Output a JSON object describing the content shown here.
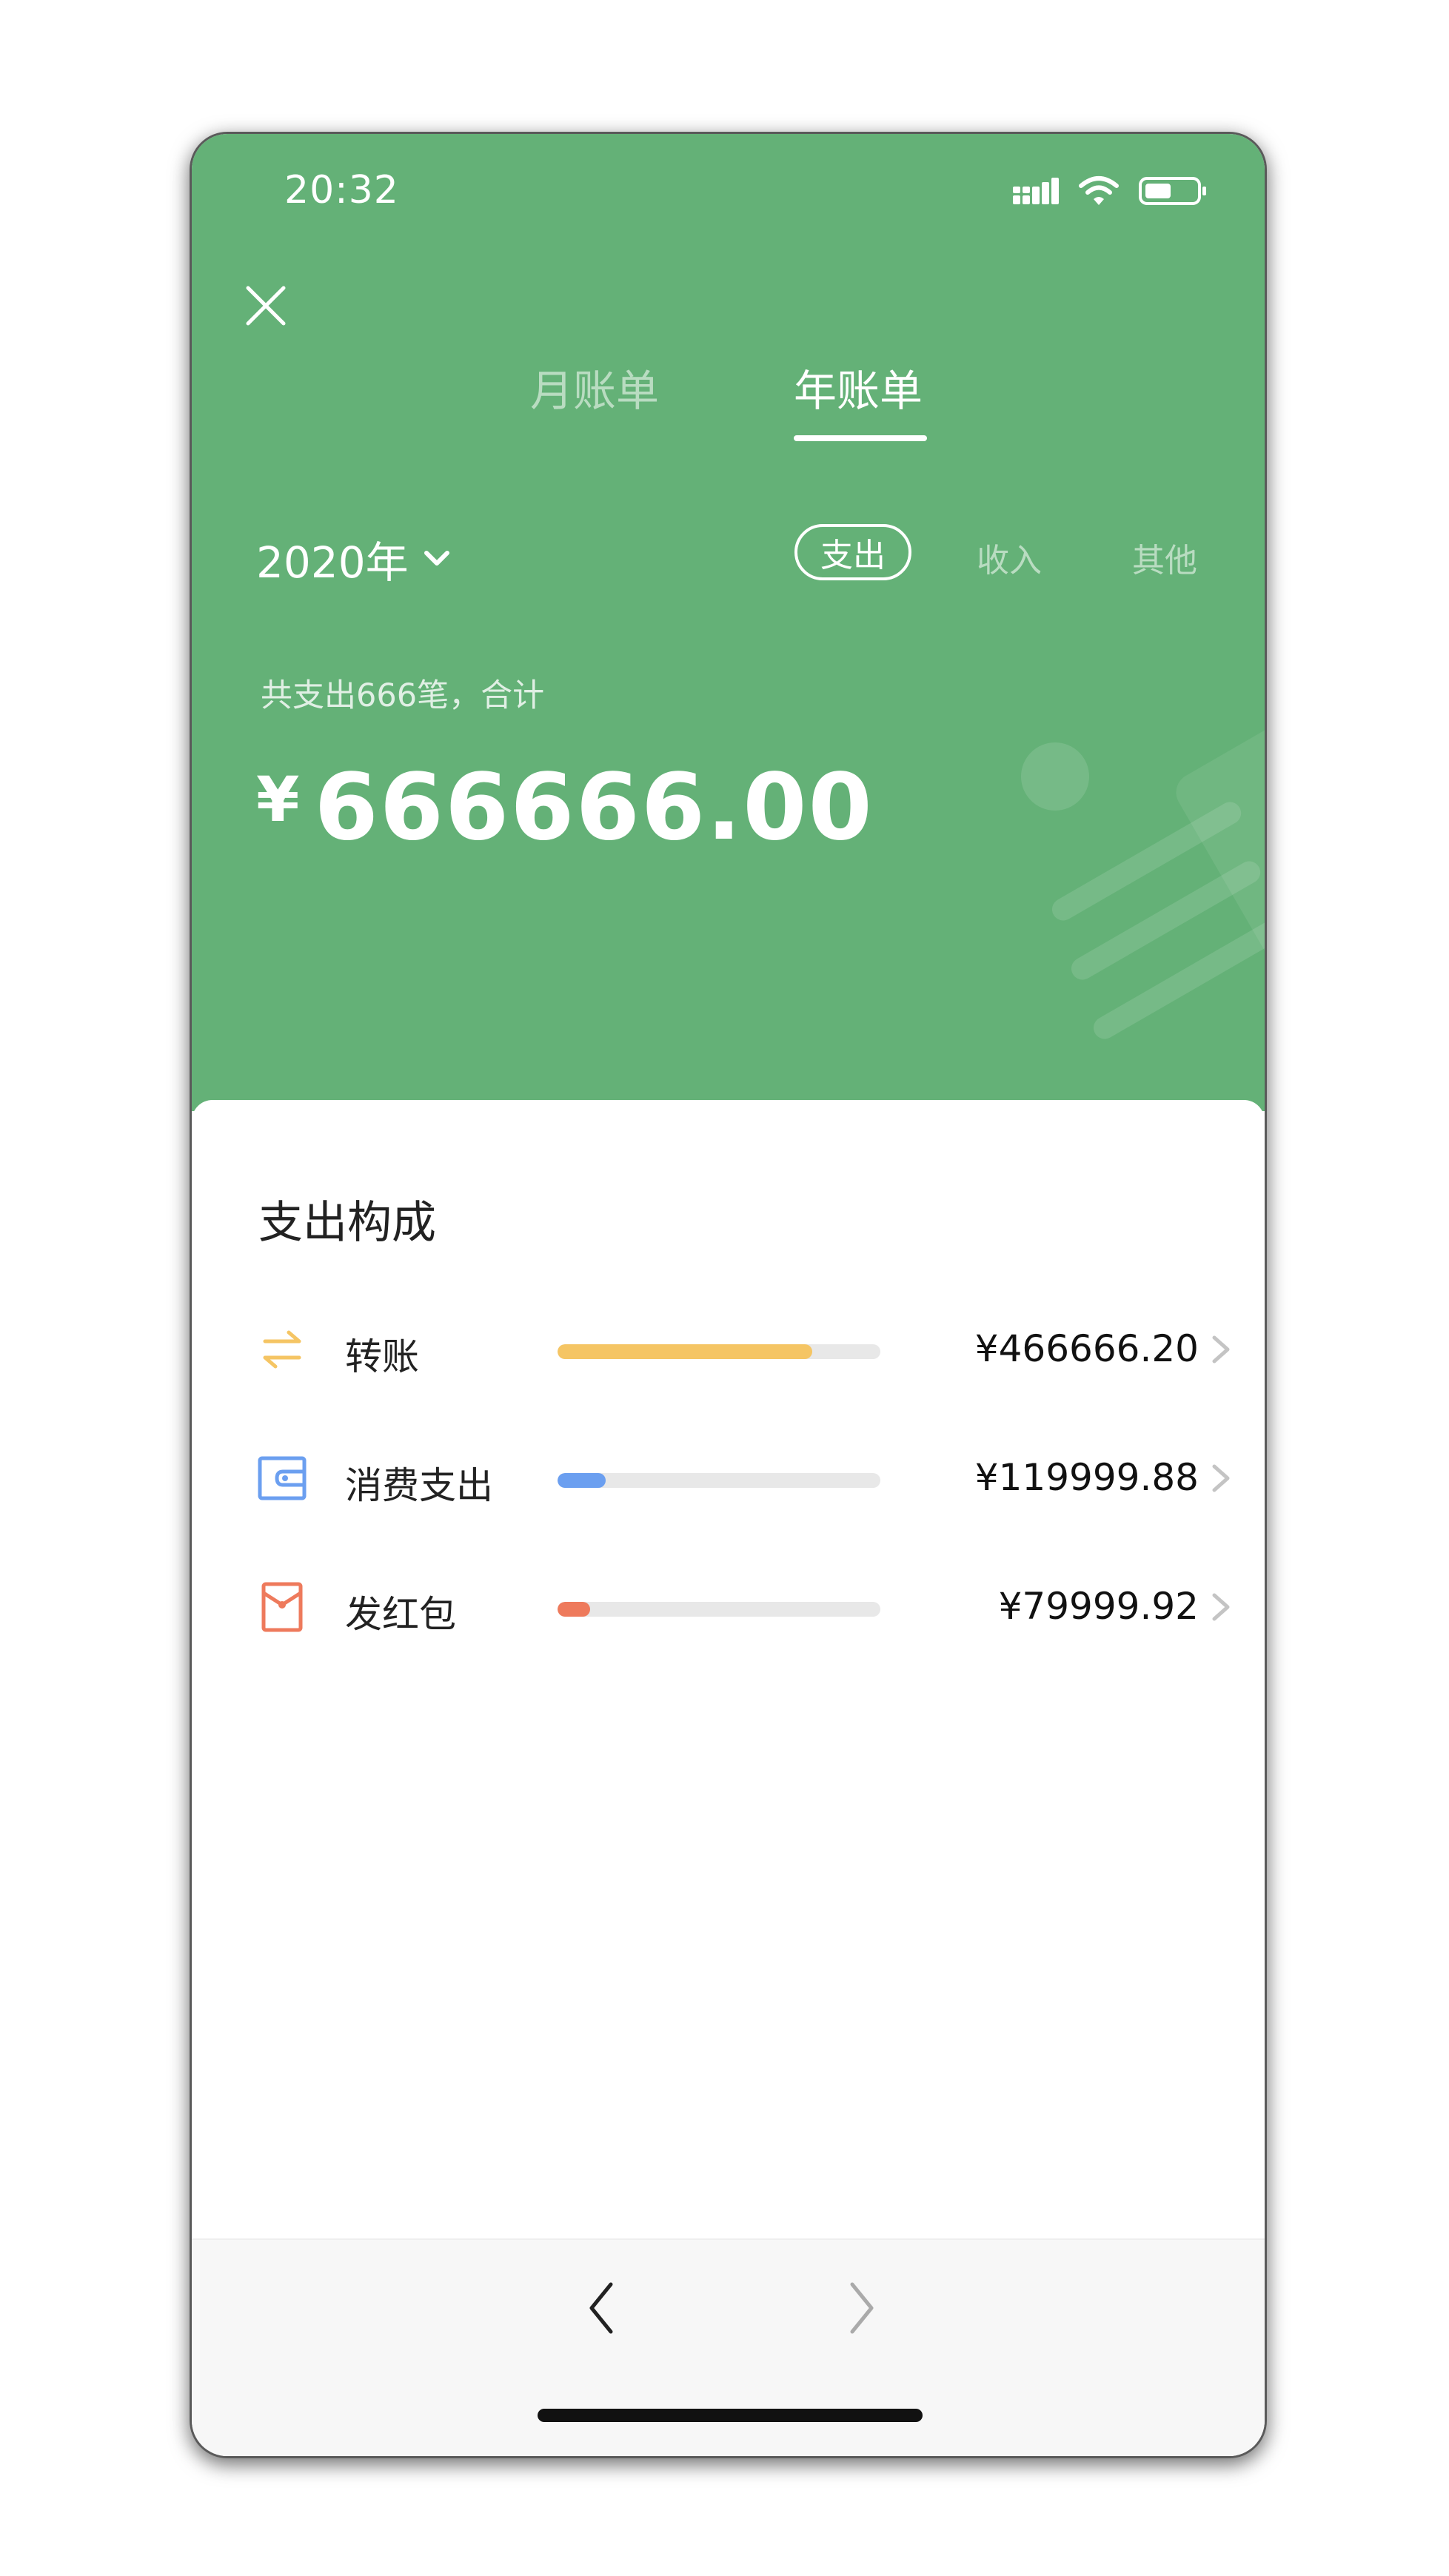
{
  "status_bar": {
    "time": "20:32"
  },
  "tabs": {
    "monthly": "月账单",
    "yearly": "年账单",
    "active": "yearly"
  },
  "year_selector": {
    "value": "2020年"
  },
  "filters": {
    "expense": "支出",
    "income": "收入",
    "other": "其他",
    "active": "expense"
  },
  "summary": {
    "text": "共支出666笔，合计",
    "currency": "¥",
    "total": "666666.00"
  },
  "composition": {
    "title": "支出构成",
    "items": [
      {
        "label": "转账",
        "amount": "¥466666.20",
        "share": 0.79,
        "color": "#f5c564",
        "icon": "transfer-icon"
      },
      {
        "label": "消费支出",
        "amount": "¥119999.88",
        "share": 0.15,
        "color": "#6b9ff0",
        "icon": "wallet-icon"
      },
      {
        "label": "发红包",
        "amount": "¥79999.92",
        "share": 0.1,
        "color": "#ee7a5c",
        "icon": "red-envelope-icon"
      }
    ]
  },
  "colors": {
    "header_green": "#64b177"
  }
}
